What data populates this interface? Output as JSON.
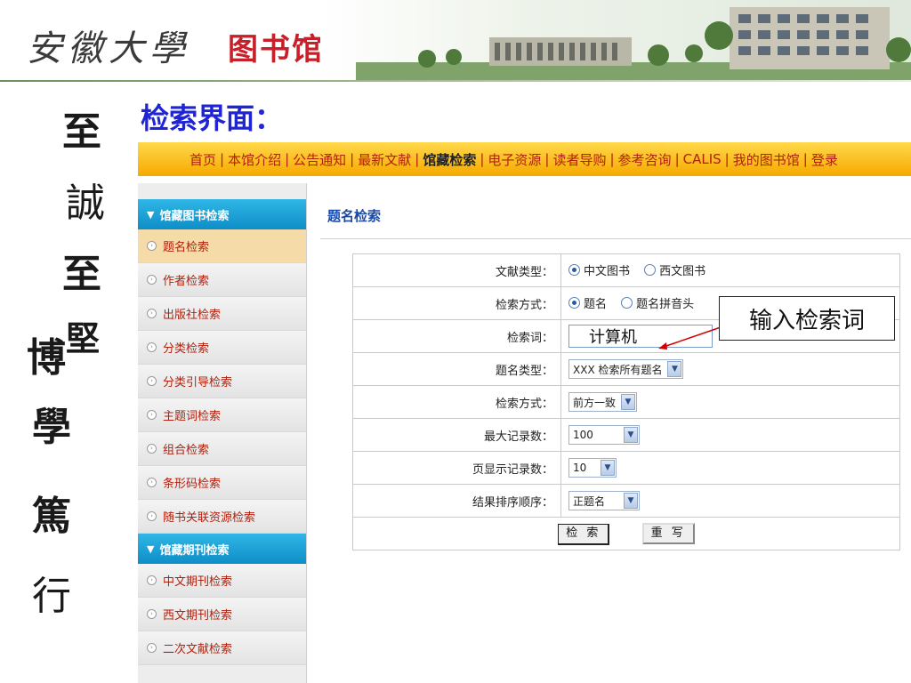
{
  "banner": {
    "calligraphy": "安徽大學",
    "library_name": "图书馆"
  },
  "motto": [
    "至",
    "誠",
    "至",
    "堅",
    "博",
    "學",
    "篤",
    "行"
  ],
  "page_title": "检索界面：",
  "topnav": {
    "items": [
      "首页",
      "本馆介绍",
      "公告通知",
      "最新文献",
      "馆藏检索",
      "电子资源",
      "读者导购",
      "参考咨询",
      "CALIS",
      "我的图书馆",
      "登录"
    ],
    "active": "馆藏检索"
  },
  "sidebar": {
    "section1": "馆藏图书检索",
    "section1_items": [
      "题名检索",
      "作者检索",
      "出版社检索",
      "分类检索",
      "分类引导检索",
      "主题词检索",
      "组合检索",
      "条形码检索",
      "随书关联资源检索"
    ],
    "section2": "馆藏期刊检索",
    "section2_items": [
      "中文期刊检索",
      "西文期刊检索",
      "二次文献检索"
    ],
    "selected": "题名检索"
  },
  "main": {
    "title": "题名检索",
    "rows": {
      "doc_type": {
        "label": "文献类型：",
        "options": [
          "中文图书",
          "西文图书"
        ],
        "selected": "中文图书"
      },
      "search_mode": {
        "label": "检索方式：",
        "options": [
          "题名",
          "题名拼音头"
        ],
        "selected": "题名"
      },
      "keyword": {
        "label": "检索词：",
        "value": "计算机"
      },
      "title_type": {
        "label": "题名类型：",
        "value": "XXX 检索所有题名"
      },
      "match_mode": {
        "label": "检索方式：",
        "value": "前方一致"
      },
      "max_records": {
        "label": "最大记录数：",
        "value": "100"
      },
      "page_records": {
        "label": "页显示记录数：",
        "value": "10"
      },
      "sort_order": {
        "label": "结果排序顺序：",
        "value": "正题名"
      }
    },
    "buttons": {
      "search": "检 索",
      "reset": "重 写"
    }
  },
  "annotation": {
    "text": "输入检索词"
  },
  "colors": {
    "nav_bg": "#f6a900",
    "nav_text": "#b3200c",
    "sidebar_head": "#0e8ec7",
    "title_blue": "#1f25d6"
  }
}
